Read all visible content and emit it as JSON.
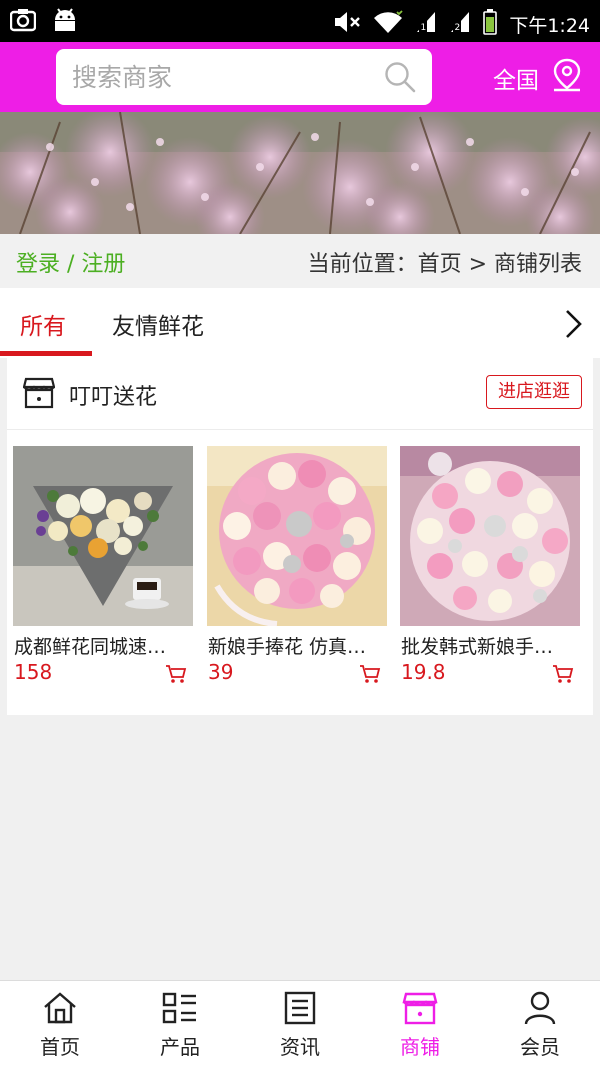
{
  "status_bar": {
    "time": "下午1:24"
  },
  "header": {
    "search_placeholder": "搜索商家",
    "region_label": "全国",
    "bg_color": "#ee1ee6"
  },
  "crumb": {
    "login_register": "登录 / 注册",
    "location": "当前位置：首页 > 商铺列表"
  },
  "tabs": [
    {
      "label": "所有",
      "active": true
    },
    {
      "label": "友情鲜花",
      "active": false
    }
  ],
  "shop": {
    "name": "叮叮送花",
    "visit_label": "进店逛逛",
    "products": [
      {
        "title": "成都鲜花同城速…",
        "price": "158"
      },
      {
        "title": "新娘手捧花 仿真…",
        "price": "39"
      },
      {
        "title": "批发韩式新娘手…",
        "price": "19.8"
      }
    ]
  },
  "bottom_nav": [
    {
      "label": "首页",
      "icon": "home-icon"
    },
    {
      "label": "产品",
      "icon": "grid-list-icon"
    },
    {
      "label": "资讯",
      "icon": "news-icon"
    },
    {
      "label": "商铺",
      "icon": "shop-icon",
      "active": true
    },
    {
      "label": "会员",
      "icon": "user-icon"
    }
  ],
  "colors": {
    "accent": "#ee1ee6",
    "price": "#d8181e",
    "login": "#4caf22"
  }
}
